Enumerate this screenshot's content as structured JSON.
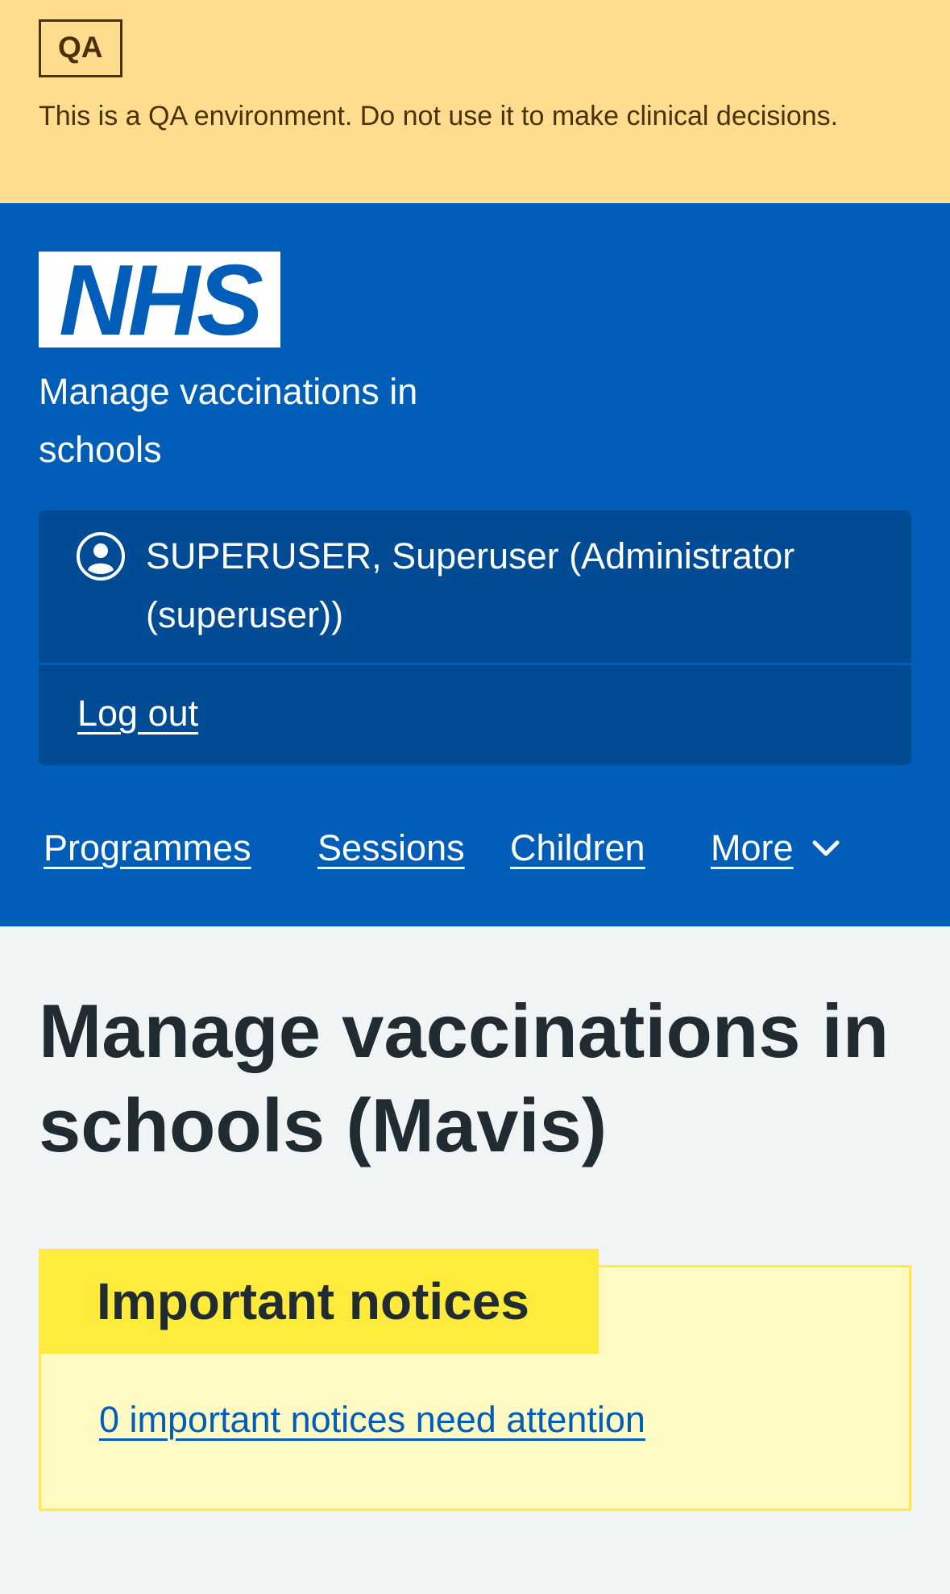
{
  "environment": {
    "tag": "QA",
    "message": "This is a QA environment. Do not use it to make clinical decisions."
  },
  "header": {
    "logo_text": "NHS",
    "service_name": "Manage vaccinations in schools",
    "account": {
      "user_icon": "user-circle-icon",
      "user_name": "SUPERUSER, Superuser (Administrator (superuser))",
      "logout_label": "Log out"
    },
    "nav": {
      "items": [
        {
          "label": "Programmes"
        },
        {
          "label": "Sessions"
        },
        {
          "label": "Children"
        }
      ],
      "more_label": "More",
      "more_icon": "chevron-down-icon"
    }
  },
  "main": {
    "title": "Manage vaccinations in schools (Mavis)",
    "notices": {
      "heading": "Important notices",
      "link_text": "0 important notices need attention"
    }
  },
  "colors": {
    "env_banner": "#ffdc8e",
    "nhs_blue": "#005eb8",
    "account_bg": "#004b93",
    "page_bg": "#f0f4f5",
    "notice_bg": "#fff9c4",
    "notice_heading_bg": "#ffeb3b",
    "text": "#212b32"
  }
}
